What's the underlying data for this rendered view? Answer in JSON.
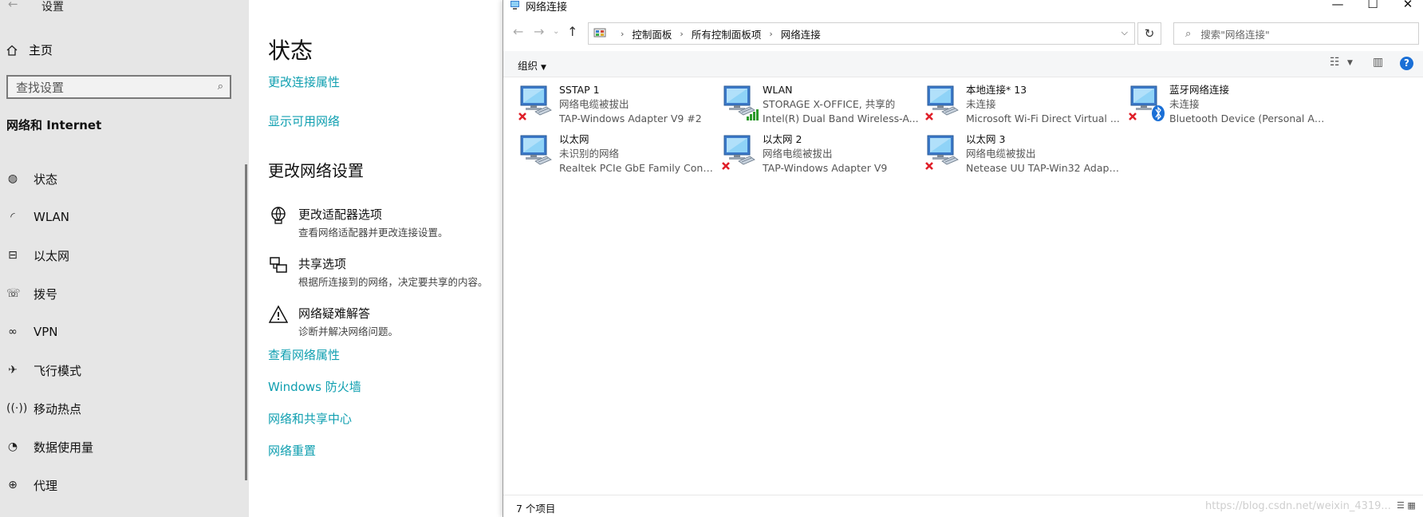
{
  "settings": {
    "app_title": "设置",
    "home": "主页",
    "search_placeholder": "查找设置",
    "section": "网络和 Internet",
    "nav": [
      {
        "label": "状态",
        "icon": "status-icon"
      },
      {
        "label": "WLAN",
        "icon": "wifi-icon"
      },
      {
        "label": "以太网",
        "icon": "ethernet-icon"
      },
      {
        "label": "拨号",
        "icon": "dialup-icon"
      },
      {
        "label": "VPN",
        "icon": "vpn-icon"
      },
      {
        "label": "飞行模式",
        "icon": "airplane-icon"
      },
      {
        "label": "移动热点",
        "icon": "hotspot-icon"
      },
      {
        "label": "数据使用量",
        "icon": "data-usage-icon"
      },
      {
        "label": "代理",
        "icon": "globe-icon"
      }
    ],
    "content": {
      "title": "状态",
      "link_change_props": "更改连接属性",
      "link_show_networks": "显示可用网络",
      "subtitle": "更改网络设置",
      "options": [
        {
          "title": "更改适配器选项",
          "desc": "查看网络适配器并更改连接设置。",
          "icon": "adapter-icon"
        },
        {
          "title": "共享选项",
          "desc": "根据所连接到的网络，决定要共享的内容。",
          "icon": "sharing-icon"
        },
        {
          "title": "网络疑难解答",
          "desc": "诊断并解决网络问题。",
          "icon": "warning-icon"
        }
      ],
      "link_view_props": "查看网络属性",
      "link_firewall": "Windows 防火墙",
      "link_sharing_center": "网络和共享中心",
      "link_reset": "网络重置"
    }
  },
  "explorer": {
    "title": "网络连接",
    "breadcrumb": [
      "控制面板",
      "所有控制面板项",
      "网络连接"
    ],
    "search_placeholder": "搜索\"网络连接\"",
    "organize": "组织",
    "connections": [
      {
        "name": "SSTAP 1",
        "status": "网络电缆被拔出",
        "device": "TAP-Windows Adapter V9 #2",
        "badge": "x",
        "type": "cable"
      },
      {
        "name": "WLAN",
        "status": "STORAGE X-OFFICE, 共享的",
        "device": "Intel(R) Dual Band Wireless-A...",
        "badge": "signal",
        "type": "wifi"
      },
      {
        "name": "本地连接* 13",
        "status": "未连接",
        "device": "Microsoft Wi-Fi Direct Virtual ...",
        "badge": "x",
        "type": "wifi"
      },
      {
        "name": "蓝牙网络连接",
        "status": "未连接",
        "device": "Bluetooth Device (Personal Ar...",
        "badge": "x",
        "type": "bluetooth"
      },
      {
        "name": "以太网",
        "status": "未识别的网络",
        "device": "Realtek PCIe GbE Family Contr...",
        "badge": "none",
        "type": "cable"
      },
      {
        "name": "以太网 2",
        "status": "网络电缆被拔出",
        "device": "TAP-Windows Adapter V9",
        "badge": "x",
        "type": "cable"
      },
      {
        "name": "以太网 3",
        "status": "网络电缆被拔出",
        "device": "Netease UU TAP-Win32 Adapt...",
        "badge": "x",
        "type": "cable"
      }
    ],
    "item_count": "7 个项目",
    "watermark": "https://blog.csdn.net/weixin_4319..."
  }
}
